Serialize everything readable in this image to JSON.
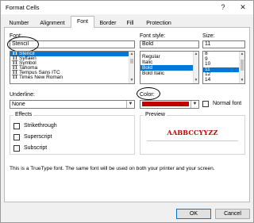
{
  "window": {
    "title": "Format Cells",
    "help_label": "?",
    "close_label": "✕"
  },
  "tabs": [
    {
      "label": "Number"
    },
    {
      "label": "Alignment"
    },
    {
      "label": "Font"
    },
    {
      "label": "Border"
    },
    {
      "label": "Fill"
    },
    {
      "label": "Protection"
    }
  ],
  "font": {
    "label": "Font:",
    "value": "Stencil",
    "items": [
      {
        "name": "Stencil",
        "selected": true
      },
      {
        "name": "Sylfaen",
        "selected": false
      },
      {
        "name": "Symbol",
        "selected": false
      },
      {
        "name": "Tahoma",
        "selected": false
      },
      {
        "name": "Tempus Sans ITC",
        "selected": false
      },
      {
        "name": "Times New Roman",
        "selected": false
      }
    ],
    "type_icon": "TT"
  },
  "style": {
    "label": "Font style:",
    "value": "Bold",
    "items": [
      {
        "name": "Regular",
        "selected": false
      },
      {
        "name": "Italic",
        "selected": false
      },
      {
        "name": "Bold",
        "selected": true
      },
      {
        "name": "Bold Italic",
        "selected": false
      }
    ]
  },
  "size": {
    "label": "Size:",
    "value": "11",
    "items": [
      {
        "name": "8",
        "selected": false
      },
      {
        "name": "9",
        "selected": false
      },
      {
        "name": "10",
        "selected": false
      },
      {
        "name": "11",
        "selected": true
      },
      {
        "name": "12",
        "selected": false
      },
      {
        "name": "14",
        "selected": false
      }
    ]
  },
  "underline": {
    "label": "Underline:",
    "value": "None"
  },
  "color": {
    "label": "Color:",
    "swatch": "#c00000",
    "normal_font_label": "Normal font"
  },
  "effects": {
    "title": "Effects",
    "items": [
      {
        "label": "Strikethrough"
      },
      {
        "label": "Superscript"
      },
      {
        "label": "Subscript"
      }
    ]
  },
  "preview": {
    "title": "Preview",
    "sample": "AABBCCYYZZ",
    "color": "#c00000"
  },
  "info_text": "This is a TrueType font.  The same font will be used on both your printer and your screen.",
  "buttons": {
    "ok": "OK",
    "cancel": "Cancel"
  },
  "colors": {
    "selection": "#0078d7"
  }
}
